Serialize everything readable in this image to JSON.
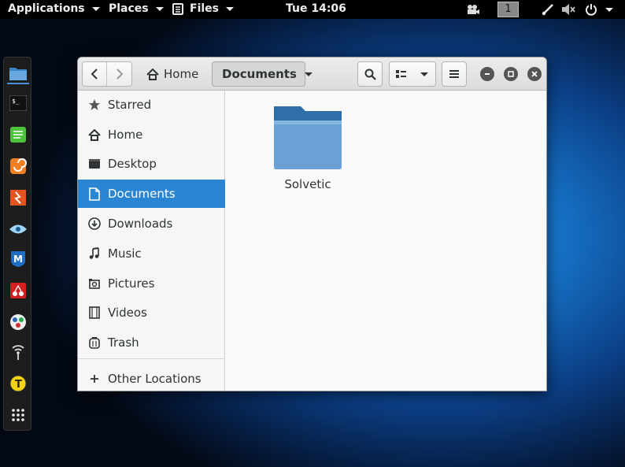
{
  "topbar": {
    "applications": "Applications",
    "places": "Places",
    "files": "Files",
    "clock": "Tue 14:06",
    "workspace": "1"
  },
  "dock": {
    "items": [
      "file-manager-icon",
      "terminal-icon",
      "text-editor-icon",
      "burp-icon",
      "app-icon-2",
      "eye-icon",
      "metasploit-icon",
      "cherry-icon",
      "maltego-icon",
      "wireless-icon",
      "yellow-app-icon",
      "app-grid-icon"
    ]
  },
  "window": {
    "breadcrumb_home": "Home",
    "breadcrumb_current": "Documents"
  },
  "sidebar": {
    "items": [
      {
        "label": "Starred",
        "icon": "star-icon"
      },
      {
        "label": "Home",
        "icon": "home-icon"
      },
      {
        "label": "Desktop",
        "icon": "desktop-icon"
      },
      {
        "label": "Documents",
        "icon": "document-icon",
        "active": true
      },
      {
        "label": "Downloads",
        "icon": "download-icon"
      },
      {
        "label": "Music",
        "icon": "music-icon"
      },
      {
        "label": "Pictures",
        "icon": "camera-icon"
      },
      {
        "label": "Videos",
        "icon": "video-icon"
      },
      {
        "label": "Trash",
        "icon": "trash-icon"
      }
    ],
    "other_locations": "Other Locations"
  },
  "content": {
    "folders": [
      {
        "name": "Solvetic",
        "color": "#6aa0d3"
      }
    ]
  },
  "colors": {
    "accent": "#2a86d2",
    "folder": "#6aa0d3"
  }
}
